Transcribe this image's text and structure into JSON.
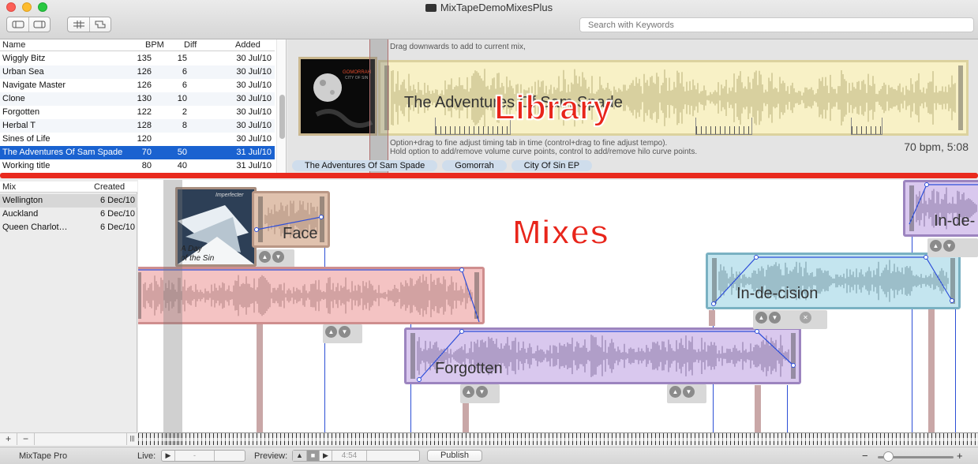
{
  "window": {
    "title": "MixTapeDemoMixesPlus",
    "search_placeholder": "Search with Keywords"
  },
  "library": {
    "columns": {
      "name": "Name",
      "bpm": "BPM",
      "diff": "Diff",
      "added": "Added"
    },
    "rows": [
      {
        "name": "Wiggly Bitz",
        "bpm": "135",
        "diff": "15",
        "added": "30 Jul/10"
      },
      {
        "name": "Urban Sea",
        "bpm": "126",
        "diff": "6",
        "added": "30 Jul/10"
      },
      {
        "name": "Navigate Master",
        "bpm": "126",
        "diff": "6",
        "added": "30 Jul/10"
      },
      {
        "name": "Clone",
        "bpm": "130",
        "diff": "10",
        "added": "30 Jul/10"
      },
      {
        "name": "Forgotten",
        "bpm": "122",
        "diff": "2",
        "added": "30 Jul/10"
      },
      {
        "name": "Herbal T",
        "bpm": "128",
        "diff": "8",
        "added": "30 Jul/10"
      },
      {
        "name": "Sines of Life",
        "bpm": "120",
        "diff": "",
        "added": "30 Jul/10"
      },
      {
        "name": "The Adventures Of Sam Spade",
        "bpm": "70",
        "diff": "50",
        "added": "31 Jul/10",
        "selected": true
      },
      {
        "name": "Working title",
        "bpm": "80",
        "diff": "40",
        "added": "31 Jul/10"
      }
    ]
  },
  "detail": {
    "hint_top": "Drag downwards to add to current mix,",
    "track_name": "The Adventures Of Sam Spade",
    "art_text_1": "GOMORRAH",
    "art_text_2": "CITY OF SIN",
    "hint_line1": "Option+drag to fine adjust timing tab in time (control+drag to fine adjust tempo).",
    "hint_line2": "Hold option to add/remove volume curve points, control to add/remove hilo curve points.",
    "bpm_time": "70 bpm, 5:08",
    "chips": [
      "The Adventures Of Sam Spade",
      "Gomorrah",
      "City Of Sin EP"
    ],
    "overlay_label": "Library"
  },
  "mixes": {
    "columns": {
      "mix": "Mix",
      "created": "Created"
    },
    "rows": [
      {
        "name": "Wellington",
        "created": "6 Dec/10",
        "selected": true
      },
      {
        "name": "Auckland",
        "created": "6 Dec/10"
      },
      {
        "name": "Queen Charlot…",
        "created": "6 Dec/10"
      }
    ],
    "add_label": "+",
    "remove_label": "−",
    "resize_label": "|||",
    "overlay_label": "Mixes",
    "clips": {
      "face": "Face",
      "forgotten": "Forgotten",
      "indecision": "In-de-cision",
      "indecision_partial": "In-de-",
      "face_art_1": "Imperfecter",
      "face_art_2": "A Day",
      "face_art_3": "of the Sin"
    }
  },
  "statusbar": {
    "app_name": "MixTape Pro",
    "live_label": "Live:",
    "preview_label": "Preview:",
    "preview_time": "4:54",
    "publish_label": "Publish",
    "zoom_minus": "−",
    "zoom_plus": "+",
    "zoom_level": 0.08
  },
  "colors": {
    "accent_red": "#e92a1e",
    "selection_blue": "#1a62d0",
    "clip_pink": "#f4c3c3",
    "clip_purple": "#d9c8ee",
    "clip_blue": "#c4e5ef",
    "clip_tan": "#e0c2ae",
    "detail_yellow": "#f8f1c6"
  }
}
